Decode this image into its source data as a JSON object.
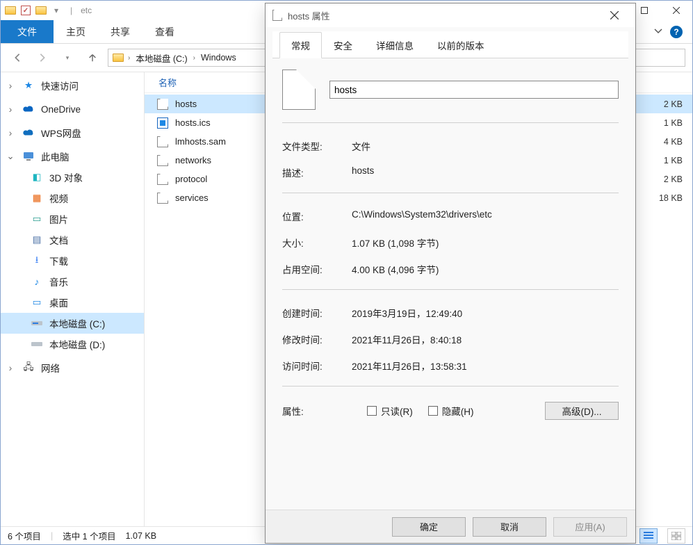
{
  "explorer": {
    "title_location": "etc",
    "ribbon": {
      "file": "文件",
      "tabs": [
        "主页",
        "共享",
        "查看"
      ]
    },
    "breadcrumb": [
      "本地磁盘 (C:)",
      "Windows"
    ],
    "list": {
      "column_name": "名称",
      "items": [
        {
          "name": "hosts",
          "size": "2 KB",
          "type": "file",
          "selected": true
        },
        {
          "name": "hosts.ics",
          "size": "1 KB",
          "type": "ics"
        },
        {
          "name": "lmhosts.sam",
          "size": "4 KB",
          "type": "file"
        },
        {
          "name": "networks",
          "size": "1 KB",
          "type": "file"
        },
        {
          "name": "protocol",
          "size": "2 KB",
          "type": "file"
        },
        {
          "name": "services",
          "size": "18 KB",
          "type": "file"
        }
      ]
    },
    "sidebar": {
      "items": [
        {
          "label": "快速访问",
          "icon": "star",
          "expandable": true
        },
        {
          "label": "OneDrive",
          "icon": "cloud",
          "expandable": true
        },
        {
          "label": "WPS网盘",
          "icon": "wps",
          "expandable": true
        },
        {
          "label": "此电脑",
          "icon": "pc",
          "expandable": true
        },
        {
          "label": "3D 对象",
          "icon": "3d",
          "indent": true
        },
        {
          "label": "视频",
          "icon": "vid",
          "indent": true
        },
        {
          "label": "图片",
          "icon": "pic",
          "indent": true
        },
        {
          "label": "文档",
          "icon": "doc",
          "indent": true
        },
        {
          "label": "下载",
          "icon": "dl",
          "indent": true
        },
        {
          "label": "音乐",
          "icon": "music",
          "indent": true
        },
        {
          "label": "桌面",
          "icon": "desk",
          "indent": true
        },
        {
          "label": "本地磁盘 (C:)",
          "icon": "disk",
          "indent": true,
          "selected": true
        },
        {
          "label": "本地磁盘 (D:)",
          "icon": "disk",
          "indent": true
        },
        {
          "label": "网络",
          "icon": "net",
          "expandable": true
        }
      ]
    },
    "status": {
      "count": "6 个项目",
      "sel": "选中 1 个项目",
      "size": "1.07 KB"
    }
  },
  "dialog": {
    "title": "hosts 属性",
    "tabs": [
      "常规",
      "安全",
      "详细信息",
      "以前的版本"
    ],
    "filename": "hosts",
    "rows": {
      "type_label": "文件类型:",
      "type_value": "文件",
      "desc_label": "描述:",
      "desc_value": "hosts",
      "loc_label": "位置:",
      "loc_value": "C:\\Windows\\System32\\drivers\\etc",
      "size_label": "大小:",
      "size_value": "1.07 KB (1,098 字节)",
      "disk_label": "占用空间:",
      "disk_value": "4.00 KB (4,096 字节)",
      "created_label": "创建时间:",
      "created_value": "2019年3月19日，12:49:40",
      "modified_label": "修改时间:",
      "modified_value": "2021年11月26日，8:40:18",
      "accessed_label": "访问时间:",
      "accessed_value": "2021年11月26日，13:58:31",
      "attr_label": "属性:",
      "readonly": "只读(R)",
      "hidden": "隐藏(H)",
      "advanced": "高级(D)..."
    },
    "buttons": {
      "ok": "确定",
      "cancel": "取消",
      "apply": "应用(A)"
    }
  }
}
